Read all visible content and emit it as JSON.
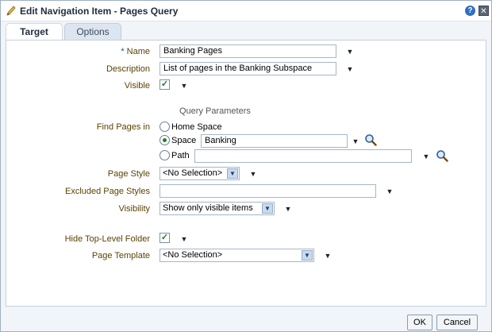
{
  "dialog": {
    "title": "Edit Navigation Item - Pages Query",
    "help_label": "?",
    "close_label": "✕"
  },
  "tabs": [
    {
      "label": "Target",
      "selected": true
    },
    {
      "label": "Options",
      "selected": false
    }
  ],
  "form": {
    "name": {
      "required_mark": "*",
      "label": "Name",
      "value": "Banking Pages"
    },
    "description": {
      "label": "Description",
      "value": "List of pages in the Banking Subspace"
    },
    "visible": {
      "label": "Visible",
      "checked": true
    },
    "query_parameters_title": "Query Parameters",
    "find_pages_in": {
      "label": "Find Pages in",
      "options": [
        {
          "label": "Home Space",
          "selected": false
        },
        {
          "label": "Space",
          "selected": true,
          "value": "Banking"
        },
        {
          "label": "Path",
          "selected": false,
          "value": ""
        }
      ]
    },
    "page_style": {
      "label": "Page Style",
      "value": "<No Selection>"
    },
    "excluded_page_styles": {
      "label": "Excluded Page Styles",
      "value": ""
    },
    "visibility": {
      "label": "Visibility",
      "value": "Show only visible items"
    },
    "hide_top_level_folder": {
      "label": "Hide Top-Level Folder",
      "checked": true
    },
    "page_template": {
      "label": "Page Template",
      "value": "<No Selection>"
    }
  },
  "icons": {
    "chevron": "chevron-down-icon",
    "search": "search-icon",
    "check": "✓",
    "dropdown_arrow": "▼"
  },
  "buttons": {
    "ok_label": "OK",
    "cancel_label": "Cancel"
  },
  "colors": {
    "label_text": "#5a4300",
    "accent": "#1a4f9c"
  }
}
